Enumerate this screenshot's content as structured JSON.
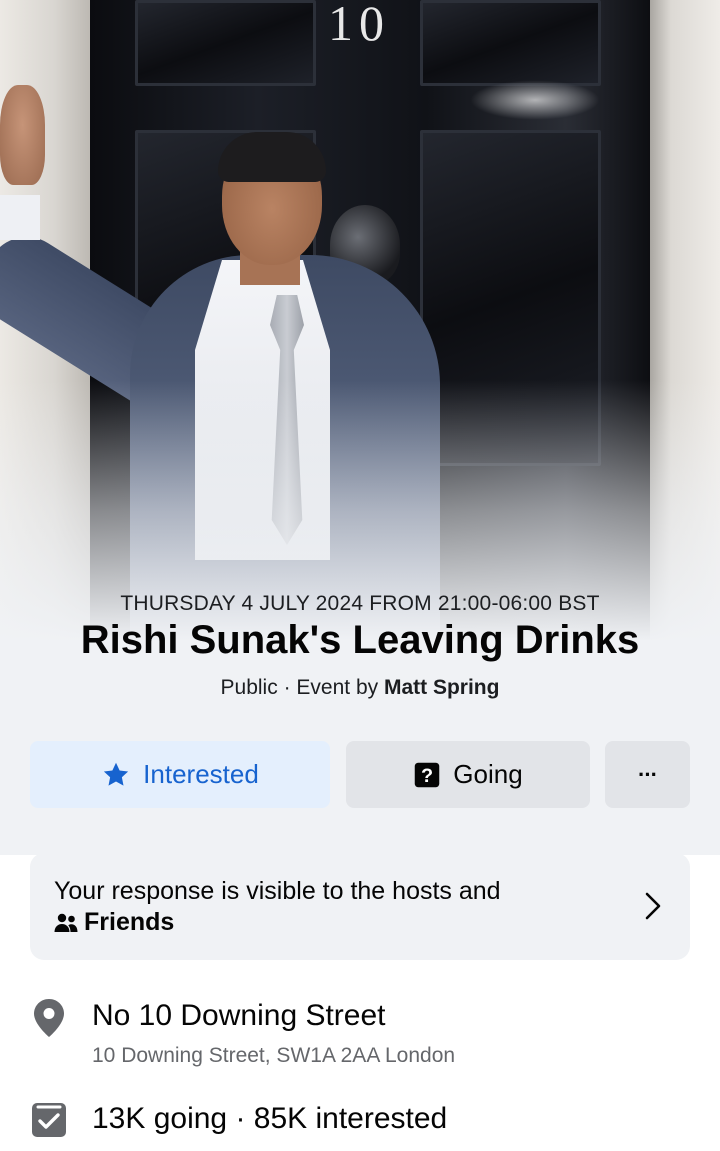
{
  "cover": {
    "door_number": "10"
  },
  "event": {
    "date_time": "THURSDAY 4 JULY 2024 FROM 21:00-06:00 BST",
    "title": "Rishi Sunak's Leaving Drinks",
    "privacy": "Public",
    "separator": " · ",
    "event_by_label": "Event by ",
    "host": "Matt Spring"
  },
  "actions": {
    "interested_label": "Interested",
    "interested_icon": "star-icon",
    "going_label": "Going",
    "going_icon": "question-box-icon",
    "more_label": "···",
    "more_icon": "more-icon"
  },
  "response": {
    "text": "Your response is visible to the hosts and",
    "audience": "Friends",
    "audience_icon": "friends-icon",
    "chevron_icon": "chevron-right-icon"
  },
  "location": {
    "name": "No 10 Downing Street",
    "address": "10 Downing Street, SW1A 2AA London",
    "icon": "location-pin-icon"
  },
  "attendance": {
    "text": "13K going · 85K interested",
    "icon": "checkbox-icon"
  },
  "colors": {
    "accent_blue": "#1763cf",
    "interested_bg": "#e4effd",
    "secondary_bg": "#e2e4e8",
    "card_bg": "#f0f2f5",
    "muted_text": "#65676b",
    "icon_gray": "#65676b"
  }
}
